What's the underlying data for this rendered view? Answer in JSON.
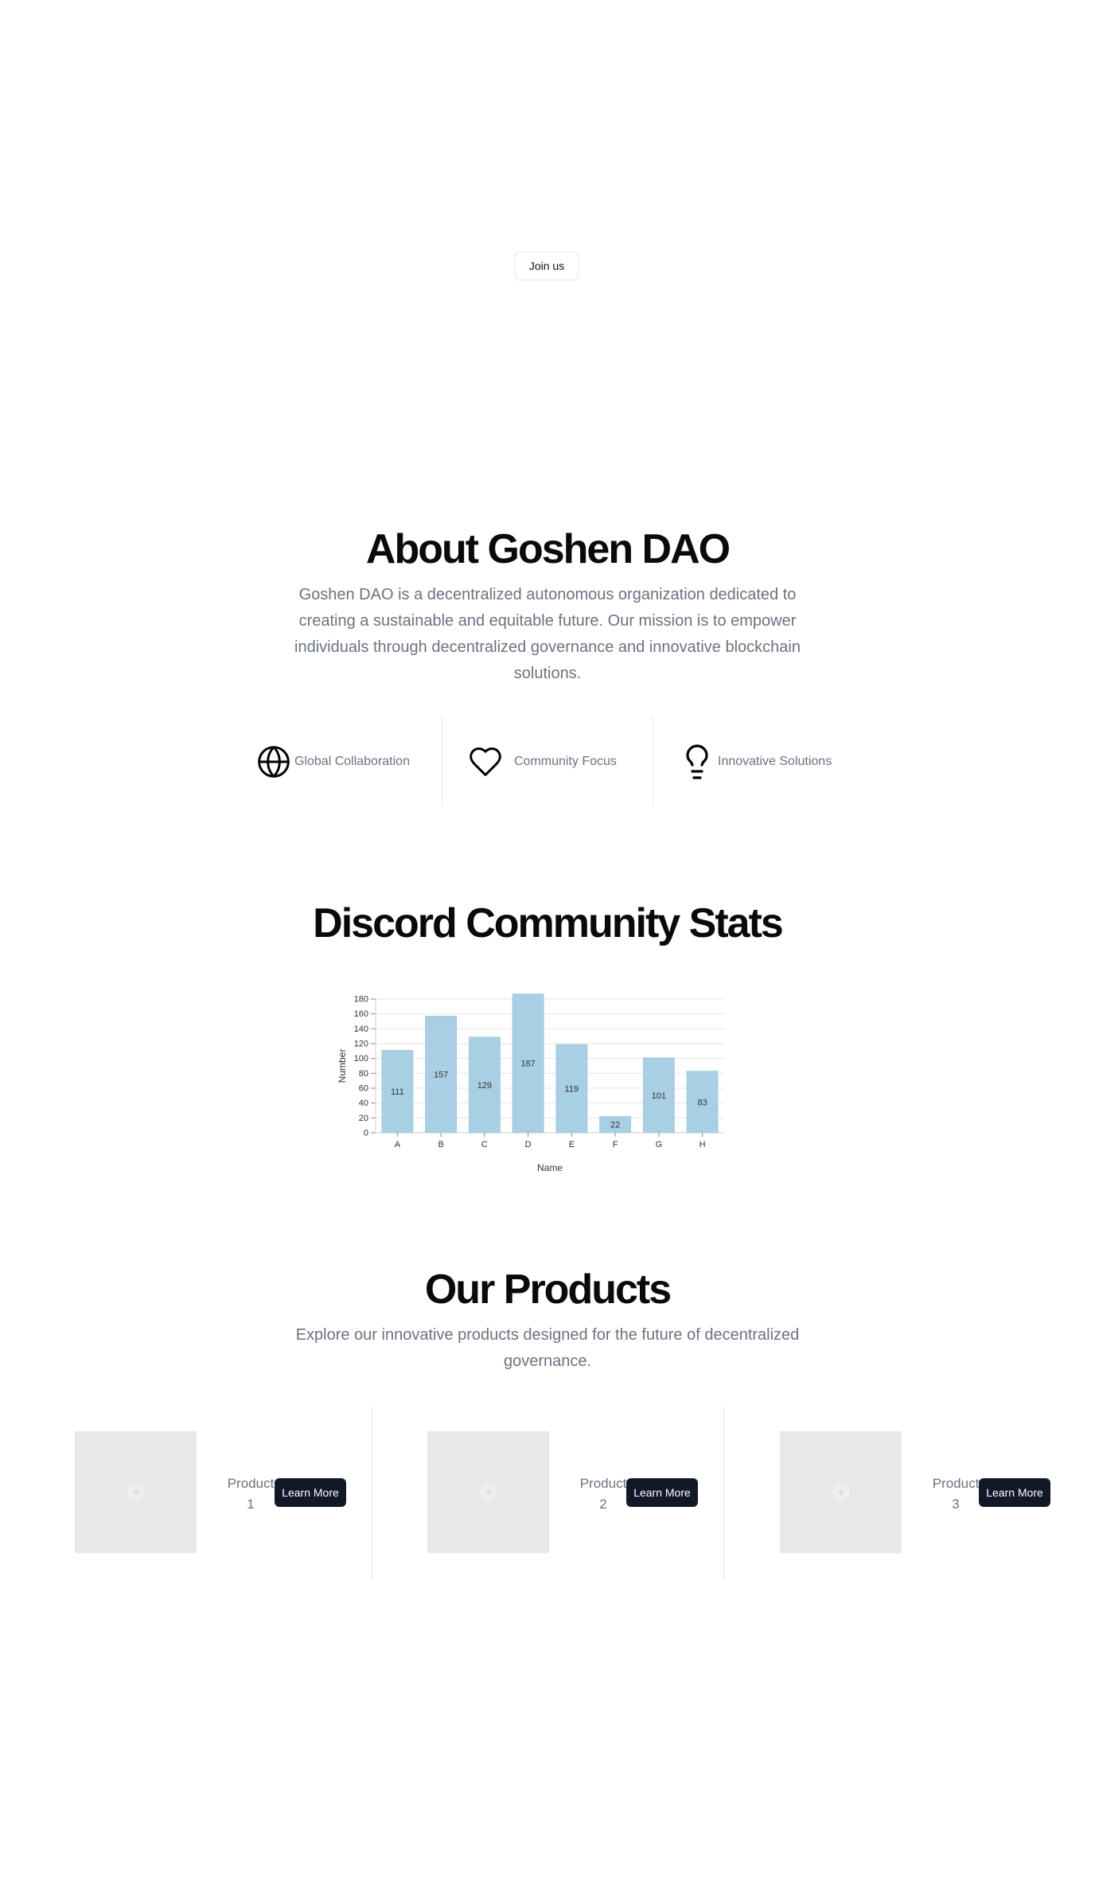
{
  "hero": {
    "join_label": "Join us"
  },
  "about": {
    "title": "About Goshen DAO",
    "description": "Goshen DAO is a decentralized autonomous organization dedicated to creating a sustainable and equitable future. Our mission is to empower individuals through decentralized governance and innovative blockchain solutions.",
    "features": [
      {
        "icon": "globe-icon",
        "label": "Global Collaboration"
      },
      {
        "icon": "heart-icon",
        "label": "Community Focus"
      },
      {
        "icon": "lightbulb-icon",
        "label": "Innovative Solutions"
      }
    ]
  },
  "stats": {
    "title": "Discord Community Stats"
  },
  "chart_data": {
    "type": "bar",
    "categories": [
      "A",
      "B",
      "C",
      "D",
      "E",
      "F",
      "G",
      "H"
    ],
    "values": [
      111,
      157,
      129,
      187,
      119,
      22,
      101,
      83
    ],
    "xlabel": "Name",
    "ylabel": "Number",
    "ylim": [
      0,
      180
    ],
    "yticks": [
      0,
      20,
      40,
      60,
      80,
      100,
      120,
      140,
      160,
      180
    ],
    "grid": true,
    "bar_color": "#a8cfe3"
  },
  "products": {
    "title": "Our Products",
    "description": "Explore our innovative products designed for the future of decentralized governance.",
    "items": [
      {
        "name": "Product 1",
        "button": "Learn More"
      },
      {
        "name": "Product 2",
        "button": "Learn More"
      },
      {
        "name": "Product 3",
        "button": "Learn More"
      }
    ]
  }
}
